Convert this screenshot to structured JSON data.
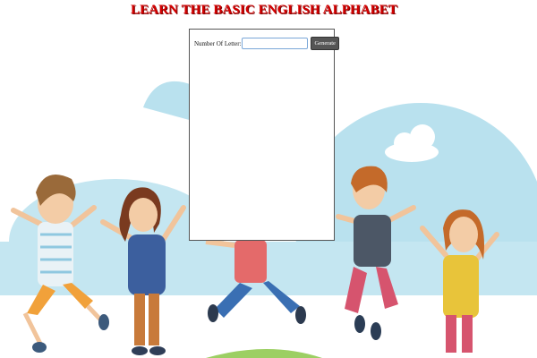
{
  "page": {
    "title": "LEARN THE BASIC ENGLISH ALPHABET"
  },
  "form": {
    "number_label": "Number Of Letter:",
    "number_value": "",
    "generate_label": "Generate"
  },
  "colors": {
    "title": "#d40000",
    "sky_blob": "#b9e1ee",
    "hill_green": "#9ccf63",
    "button": "#555555"
  }
}
